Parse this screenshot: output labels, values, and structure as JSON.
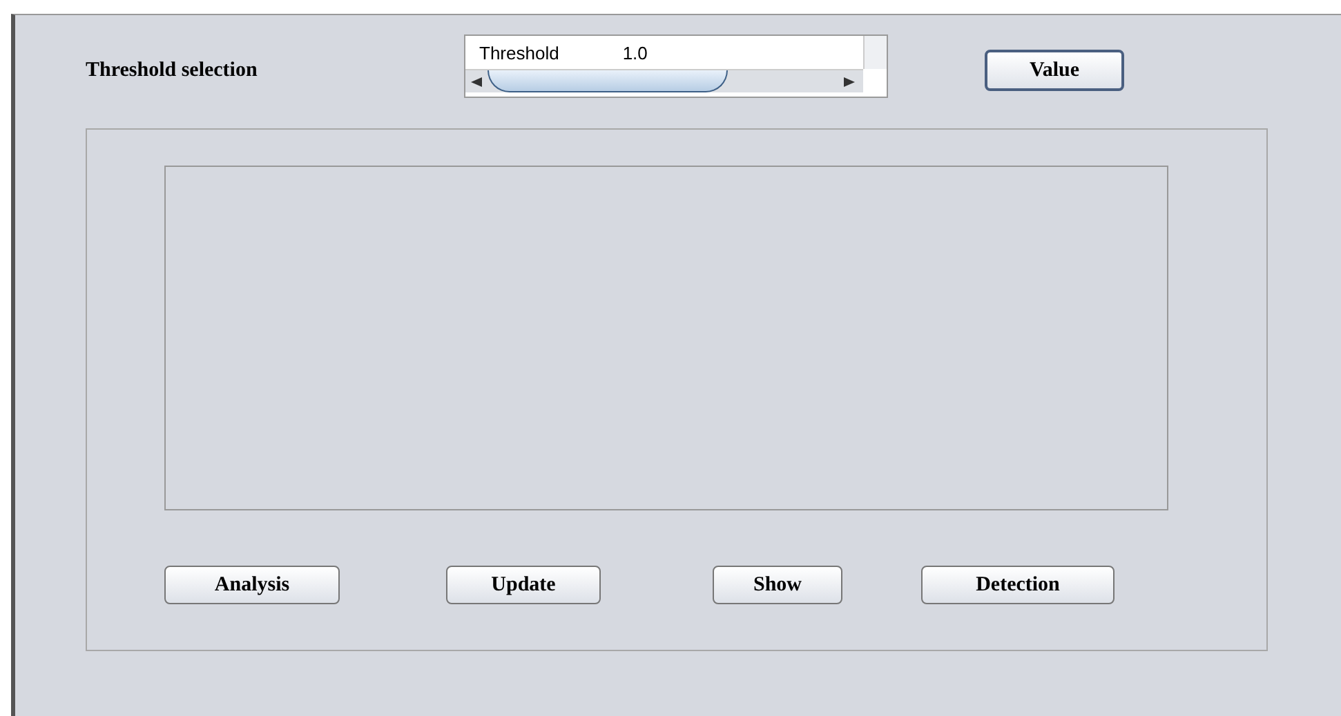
{
  "threshold_label": "Threshold selection",
  "threshold_table": {
    "name": "Threshold",
    "value": "1.0"
  },
  "value_button": "Value",
  "buttons": [
    "Analysis",
    "Update",
    "Show",
    "Detection"
  ]
}
